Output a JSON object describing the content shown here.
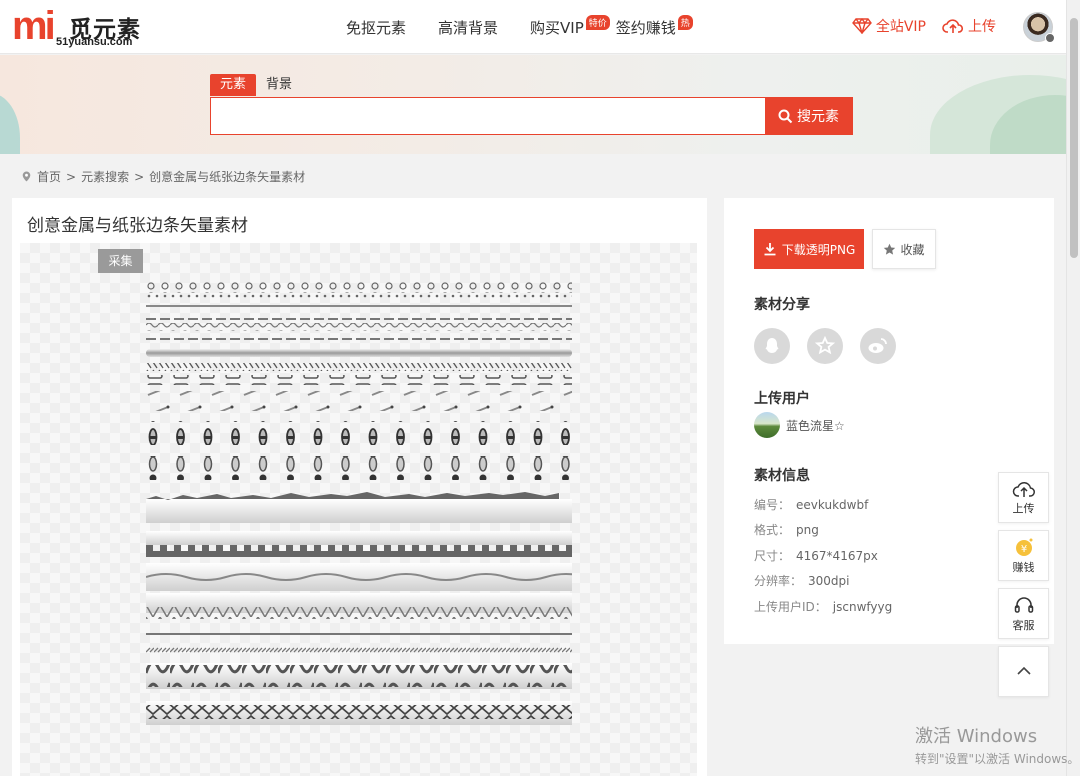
{
  "logo": {
    "mark": "mi",
    "name": "觅元素",
    "domain": "51yuansu.com"
  },
  "nav": [
    {
      "label": "免抠元素",
      "badge": ""
    },
    {
      "label": "高清背景",
      "badge": ""
    },
    {
      "label": "购买VIP",
      "badge": "特价"
    },
    {
      "label": "签约赚钱",
      "badge": "热"
    }
  ],
  "header_right": {
    "vip_label": "全站VIP",
    "upload_label": "上传"
  },
  "search": {
    "tabs": [
      "元素",
      "背景"
    ],
    "active_tab": "元素",
    "value": "",
    "button_label": "搜元素"
  },
  "breadcrumb": [
    "首页",
    "元素搜索",
    "创意金属与纸张边条矢量素材"
  ],
  "breadcrumb_sep": ">",
  "page_title": "创意金属与纸张边条矢量素材",
  "collect_label": "采集",
  "download_label": "下载透明PNG",
  "favorite_label": "收藏",
  "share": {
    "title": "素材分享",
    "icons": [
      "qq-icon",
      "qzone-icon",
      "weibo-icon"
    ]
  },
  "uploader": {
    "title": "上传用户",
    "name": "蓝色流星☆"
  },
  "info": {
    "title": "素材信息",
    "rows": [
      {
        "k": "编号：",
        "v": "eevkukdwbf"
      },
      {
        "k": "格式：",
        "v": "png"
      },
      {
        "k": "尺寸：",
        "v": "4167*4167px"
      },
      {
        "k": "分辨率：",
        "v": "300dpi"
      },
      {
        "k": "上传用户ID：",
        "v": "jscnwfyyg"
      }
    ]
  },
  "float_tools": {
    "upload": "上传",
    "earn": "赚钱",
    "service": "客服"
  },
  "watermark": {
    "line1": "激活 Windows",
    "line2": "转到\"设置\"以激活 Windows。"
  },
  "colors": {
    "accent": "#e8432d",
    "page_bg": "#f2f2f2",
    "panel_bg": "#ffffff"
  }
}
